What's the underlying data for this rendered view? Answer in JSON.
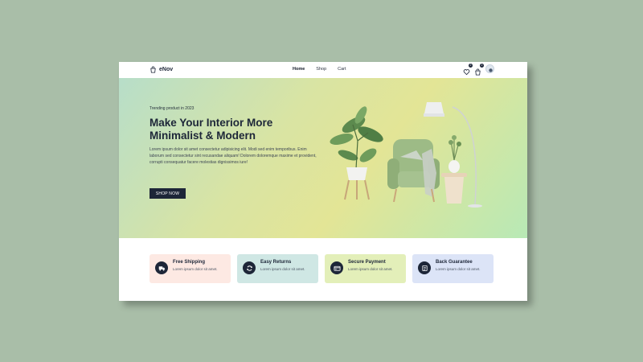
{
  "brand": {
    "name": "eNov"
  },
  "nav": {
    "links": [
      {
        "label": "Home",
        "active": true
      },
      {
        "label": "Shop",
        "active": false
      },
      {
        "label": "Cart",
        "active": false
      }
    ],
    "icons": [
      {
        "name": "heart-icon",
        "count": "2"
      },
      {
        "name": "bag-icon",
        "count": "2"
      },
      {
        "name": "avatar-icon"
      }
    ]
  },
  "hero": {
    "eyebrow": "Trending product in 2023",
    "title": "Make Your Interior More Minimalist & Modern",
    "description": "Lorem ipsum dolor sit amet consectetur adipisicing elit. Modi sed enim temporibus. Enim laborum sed consectetur sint recusandae aliquam! Dolorem doloremque maxime et provident, corrupti consequatur facere molestias dignissimos iure!",
    "cta": "SHOP NOW"
  },
  "features": [
    {
      "title": "Free Shipping",
      "description": "Lorem ipsum dolor sit amet.",
      "icon": "truck-icon",
      "color": "#fde9e3"
    },
    {
      "title": "Easy Returns",
      "description": "Lorem ipsum dolor sit amet.",
      "icon": "refresh-icon",
      "color": "#cfe7e4"
    },
    {
      "title": "Secure Payment",
      "description": "Lorem ipsum dolor sit amet.",
      "icon": "card-icon",
      "color": "#e3efb9"
    },
    {
      "title": "Back Guarantee",
      "description": "Lorem ipsum dolor sit amet.",
      "icon": "badge-icon",
      "color": "#dce4f7"
    }
  ],
  "colors": {
    "accent": "#1d2638",
    "page_bg": "#a9bea8"
  }
}
